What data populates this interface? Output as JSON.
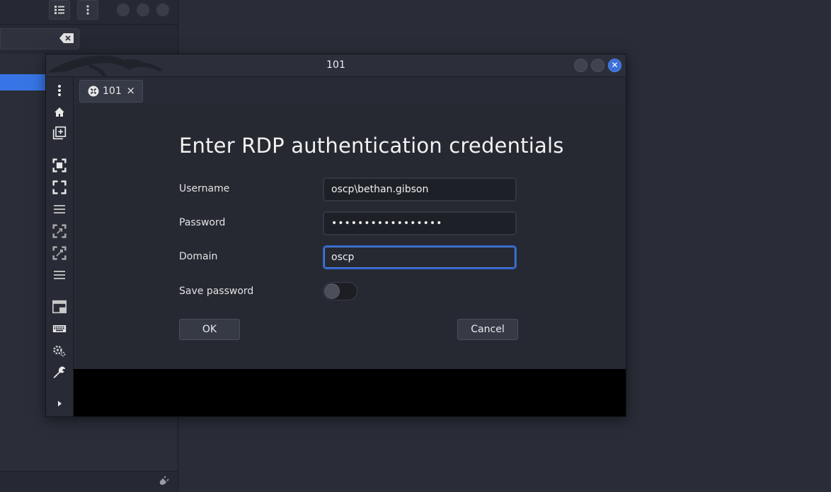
{
  "background_window": {
    "toolbar_icons": [
      "list-icon",
      "kebab-menu-icon"
    ],
    "window_controls": [
      "minimize",
      "maximize",
      "close"
    ],
    "search_clear_icon": "clear-text-icon",
    "status_icon": "plug-icon"
  },
  "dialog_window": {
    "title": "101",
    "controls": [
      "minimize",
      "maximize",
      "close"
    ],
    "close_glyph": "✕",
    "tab": {
      "label": "101",
      "icon": "rdp-protocol-icon",
      "close_glyph": "×"
    },
    "sidebar_icons": [
      "kebab-menu-icon",
      "home-icon",
      "new-tab-icon",
      "fit-window-icon",
      "fullscreen-icon",
      "menu-lines-icon",
      "scale-icon",
      "dynamic-resolution-icon",
      "menu-lines-icon",
      "multi-monitor-icon",
      "keyboard-icon",
      "preferences-icon",
      "tools-icon",
      "expand-arrow-icon"
    ]
  },
  "auth_form": {
    "heading": "Enter RDP authentication credentials",
    "username_label": "Username",
    "username_value": "oscp\\bethan.gibson",
    "password_label": "Password",
    "password_value": "•••••••••••••••••",
    "domain_label": "Domain",
    "domain_value": "oscp",
    "save_password_label": "Save password",
    "save_password_enabled": false,
    "ok_label": "OK",
    "cancel_label": "Cancel"
  },
  "colors": {
    "accent": "#3775e6",
    "focus_border": "#2e64c9",
    "background": "#2a2d38",
    "dialog_content": "#262932"
  }
}
